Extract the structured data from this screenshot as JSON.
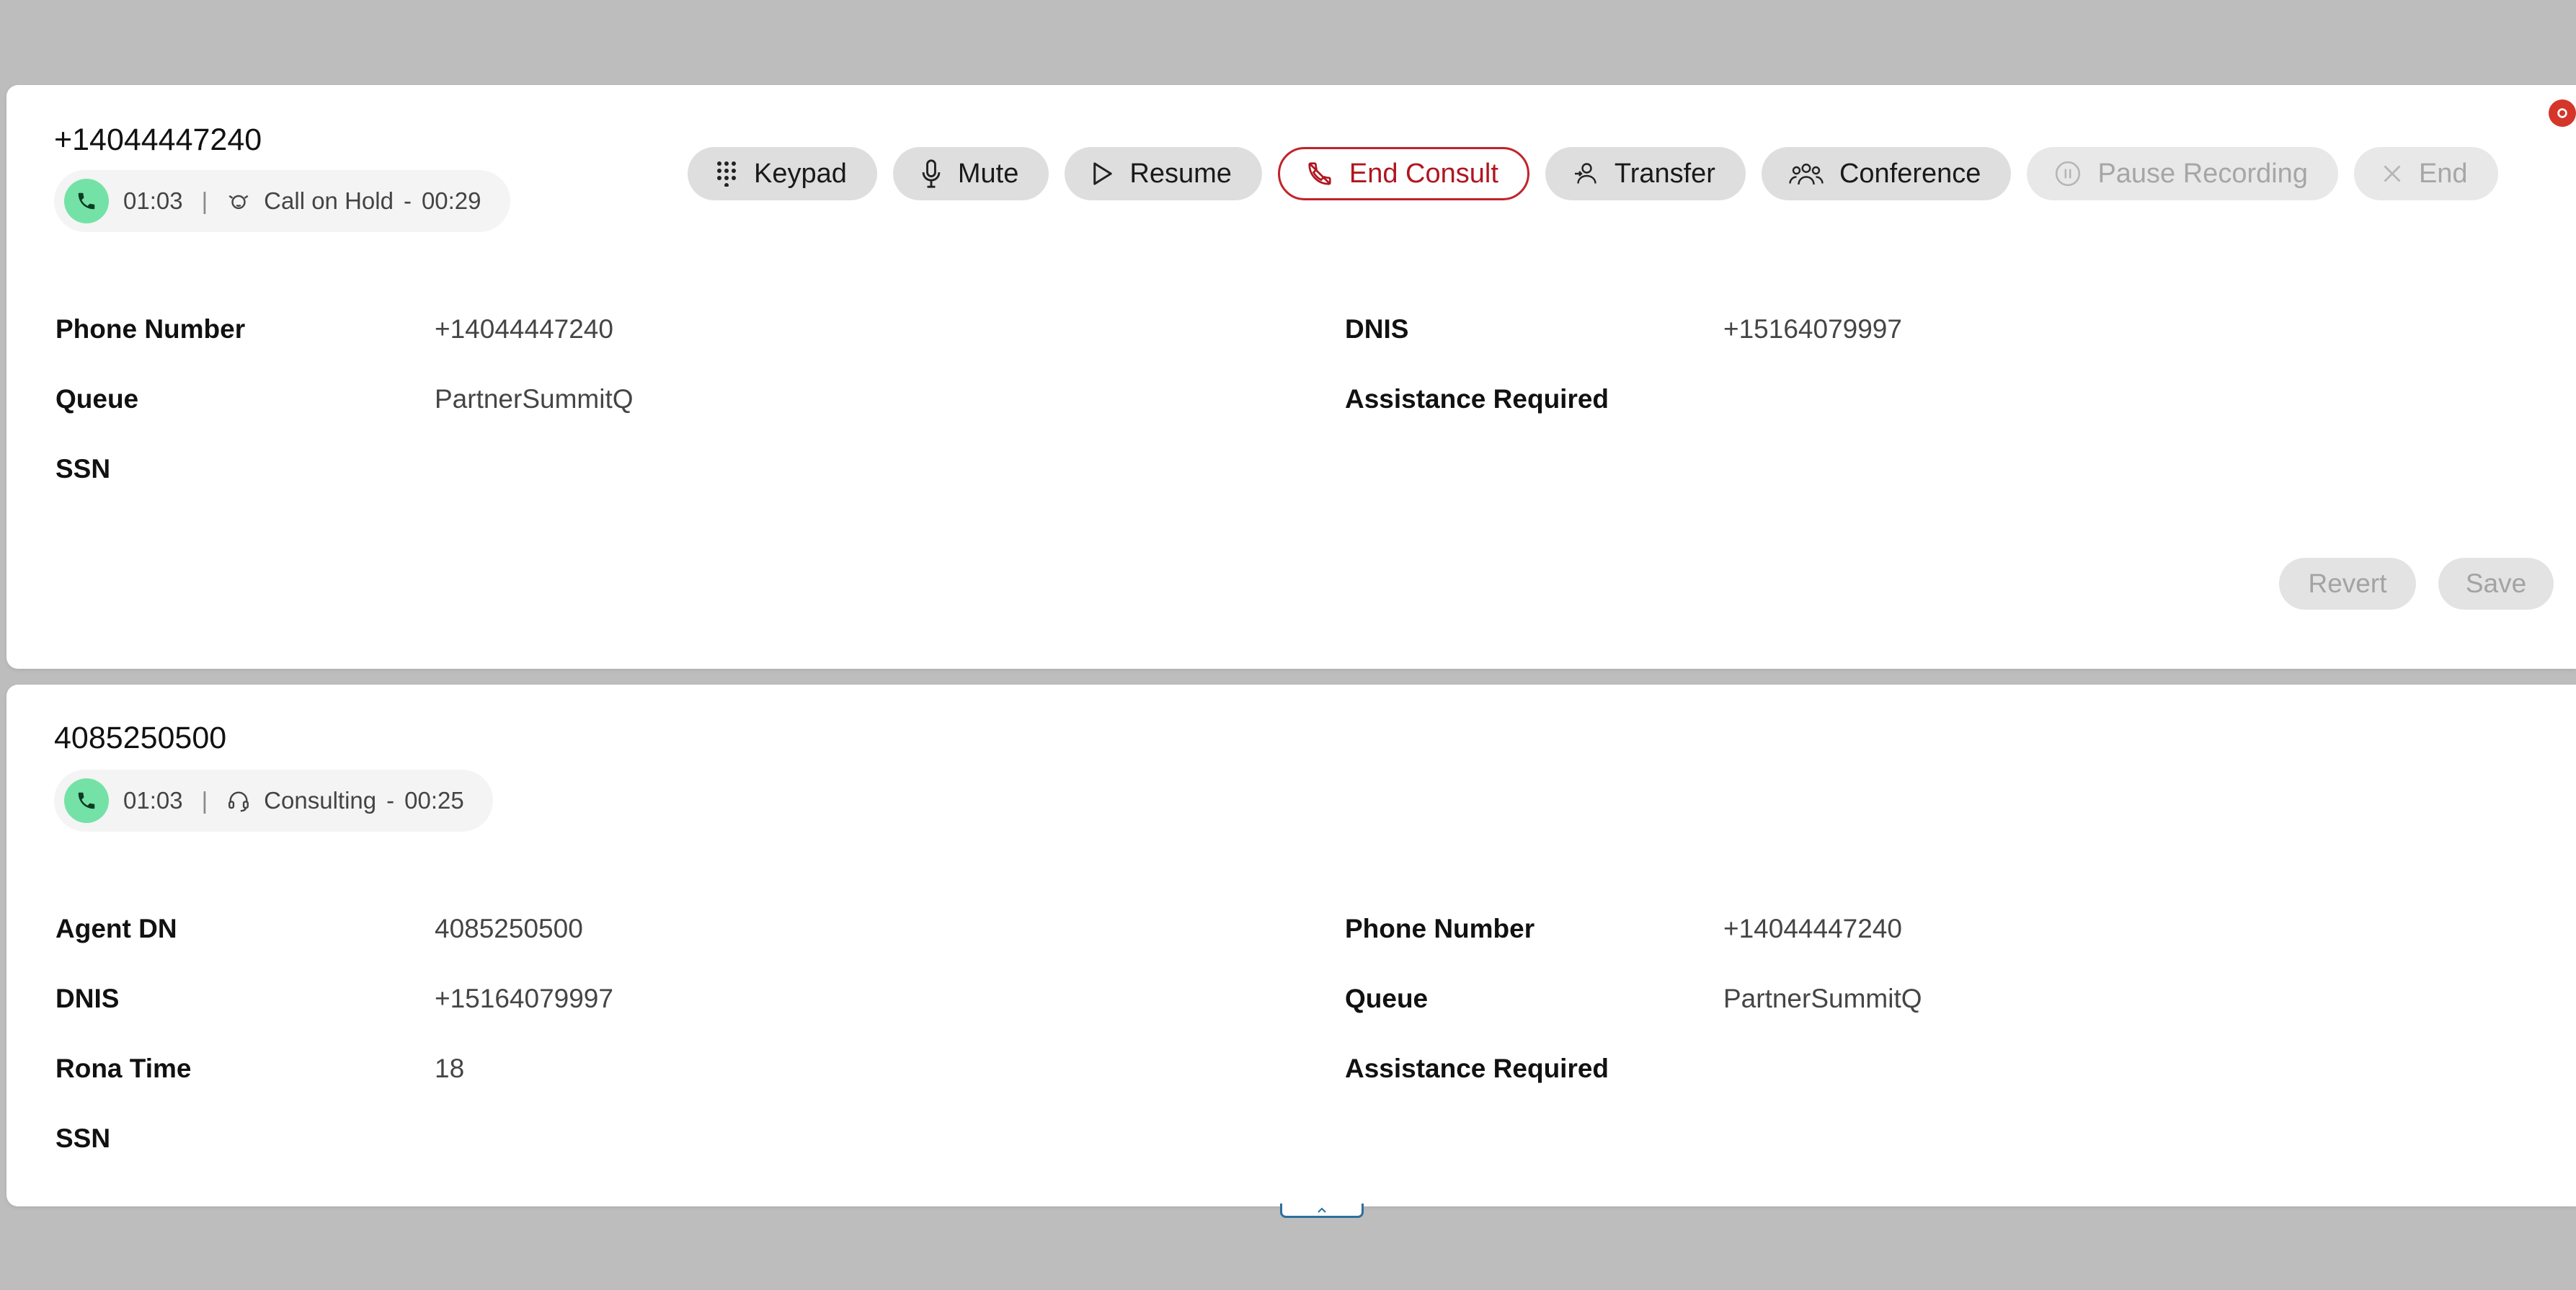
{
  "colors": {
    "accent_red": "#c1232b",
    "call_green": "#74e2a6",
    "badge_red": "#d4362a"
  },
  "task1": {
    "title": "+14044447240",
    "call_time": "01:03",
    "separator": "|",
    "state_label": "Call on Hold",
    "state_dash": "-",
    "state_time": "00:29",
    "state_icon": "hold-icon",
    "controls": {
      "keypad": "Keypad",
      "mute": "Mute",
      "resume": "Resume",
      "end_consult": "End Consult",
      "transfer": "Transfer",
      "conference": "Conference",
      "pause_recording": "Pause Recording",
      "end": "End"
    },
    "fields": [
      {
        "label": "Phone Number",
        "value": "+14044447240"
      },
      {
        "label": "DNIS",
        "value": "+15164079997"
      },
      {
        "label": "Queue",
        "value": "PartnerSummitQ"
      },
      {
        "label": "Assistance Required",
        "value": ""
      },
      {
        "label": "SSN",
        "value": ""
      }
    ],
    "revert_label": "Revert",
    "save_label": "Save"
  },
  "task2": {
    "title": "4085250500",
    "call_time": "01:03",
    "separator": "|",
    "state_label": "Consulting",
    "state_dash": "-",
    "state_time": "00:25",
    "state_icon": "headset-icon",
    "fields": [
      {
        "label": "Agent DN",
        "value": "4085250500"
      },
      {
        "label": "Phone Number",
        "value": "+14044447240"
      },
      {
        "label": "DNIS",
        "value": "+15164079997"
      },
      {
        "label": "Queue",
        "value": "PartnerSummitQ"
      },
      {
        "label": "Rona Time",
        "value": "18"
      },
      {
        "label": "Assistance Required",
        "value": ""
      },
      {
        "label": "SSN",
        "value": ""
      }
    ]
  }
}
